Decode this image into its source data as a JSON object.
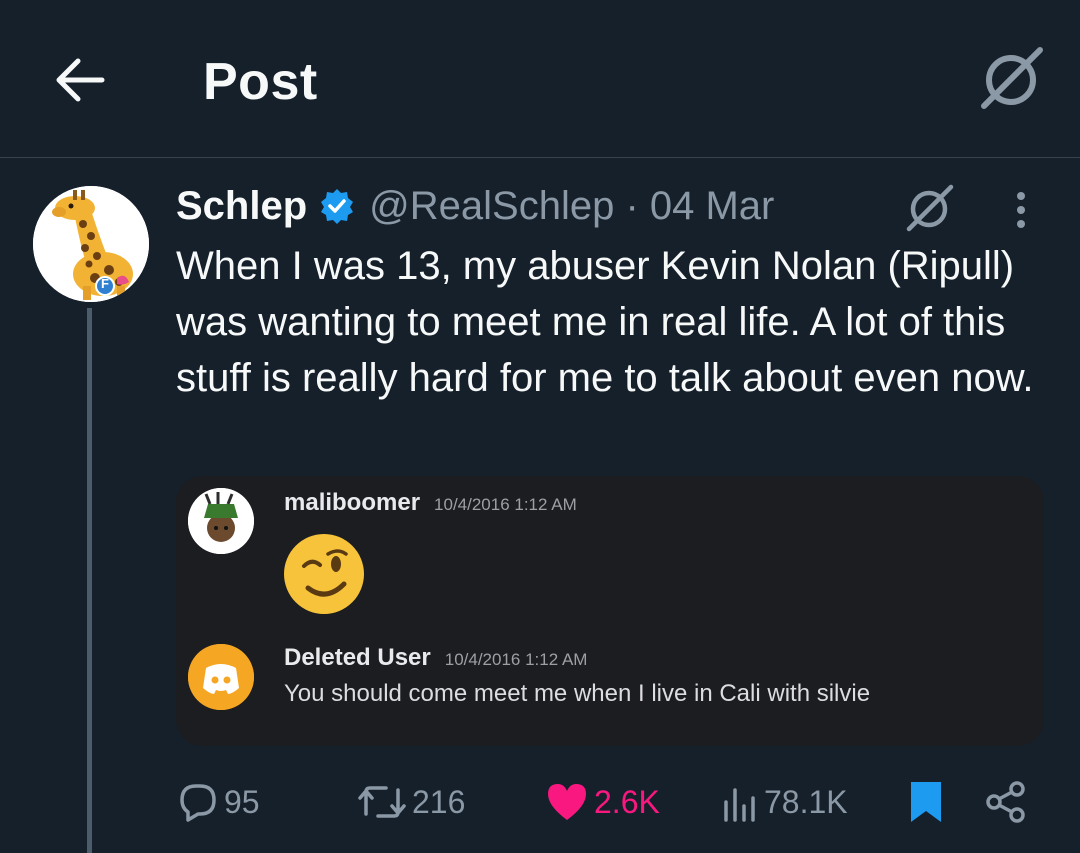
{
  "header": {
    "title": "Post",
    "back_icon": "arrow-left-icon",
    "grok_icon": "grok-icon"
  },
  "tweet": {
    "author": "Schlep",
    "verified": true,
    "handle_date": "@RealSchlep · 04 Mar",
    "text": "When I was 13, my abuser Kevin Nolan (Ripull) was wanting to meet me in real life. A lot of this stuff is really hard for me to talk about even now.",
    "avatar_badge": "F"
  },
  "embed": {
    "messages": [
      {
        "username": "maliboomer",
        "timestamp": "10/4/2016 1:12 AM",
        "content_emoji": "winking-face"
      },
      {
        "username": "Deleted User",
        "timestamp": "10/4/2016 1:12 AM",
        "content": "You should come meet me when I live in Cali with silvie"
      }
    ]
  },
  "actions": {
    "replies": "95",
    "reposts": "216",
    "likes": "2.6K",
    "views": "78.1K",
    "bookmarked": true
  },
  "colors": {
    "background": "#15202b",
    "secondary_text": "#8b98a5",
    "verified": "#1d9bf0",
    "like": "#f91880",
    "bookmark": "#1d9bf0",
    "embed_bg": "#1c1d21"
  }
}
